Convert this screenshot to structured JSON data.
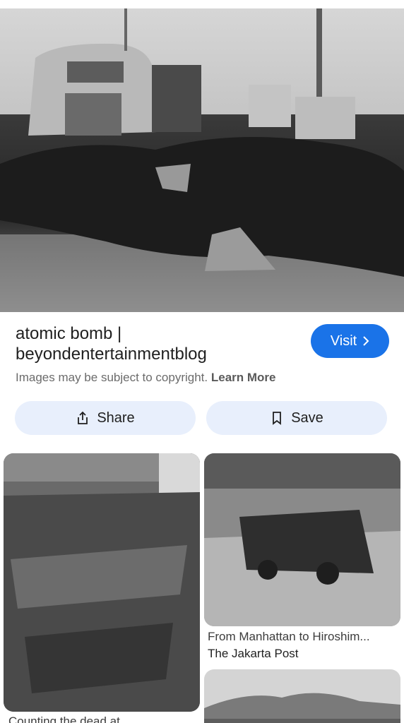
{
  "result": {
    "title_line1": "atomic bomb |",
    "title_line2": "beyondentertainmentblog",
    "copyright_text": "Images may be subject to copyright.",
    "learn_more": "Learn More",
    "visit_label": "Visit"
  },
  "actions": {
    "share_label": "Share",
    "save_label": "Save"
  },
  "related": [
    {
      "caption_line1": "Counting the dead at",
      "caption_line2": ""
    },
    {
      "caption_line1": "From Manhattan to Hiroshim...",
      "caption_line2": "The Jakarta Post"
    },
    {
      "caption_line1": "",
      "caption_line2": ""
    }
  ],
  "colors": {
    "accent": "#1a73e8",
    "button_bg": "#e8effc"
  },
  "icons": {
    "visit": "chevron-right-icon",
    "share": "share-icon",
    "save": "bookmark-icon"
  }
}
